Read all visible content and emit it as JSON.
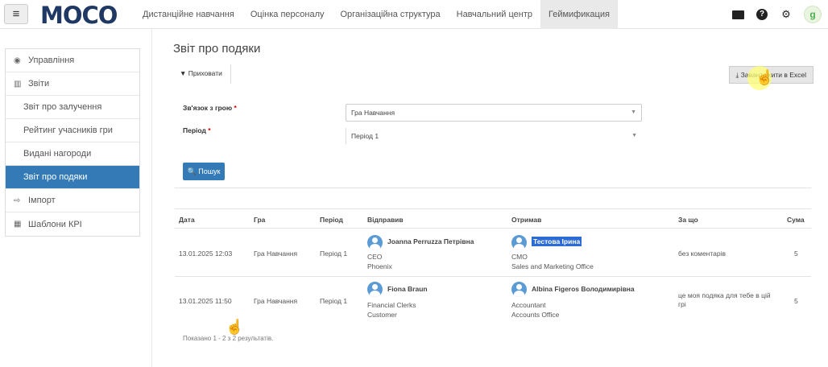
{
  "topbar": {
    "logo": "MOCO",
    "nav": [
      {
        "label": "Дистанційне навчання"
      },
      {
        "label": "Оцінка персоналу"
      },
      {
        "label": "Організаційна структура"
      },
      {
        "label": "Навчальний центр"
      },
      {
        "label": "Геймификация"
      }
    ],
    "icons": [
      "envelope-icon",
      "question-icon",
      "gear-icon",
      "avatar"
    ]
  },
  "sidebar": {
    "items": [
      {
        "label": "Управління",
        "icon": "gamepad-icon"
      },
      {
        "label": "Звіти",
        "icon": "bar-chart-icon"
      },
      {
        "label": "Звіт про залучення"
      },
      {
        "label": "Рейтинг учасників гри"
      },
      {
        "label": "Видані нагороди"
      },
      {
        "label": "Звіт про подяки"
      },
      {
        "label": "Імпорт",
        "icon": "import-icon"
      },
      {
        "label": "Шаблони КРІ",
        "icon": "table-icon"
      }
    ]
  },
  "main": {
    "title": "Звіт про подяки",
    "filter_button": "Приховати",
    "export_button": "Завантажити в Excel",
    "form": {
      "game_label": "Зв'язок з грою",
      "game_value": "Гра Навчання",
      "period_label": "Період",
      "period_value": "Період 1",
      "search_button": "Пошук"
    },
    "table": {
      "headers": [
        "Дата",
        "Гра",
        "Період",
        "Відправив",
        "Отримав",
        "За що",
        "Сума"
      ],
      "rows": [
        {
          "date": "13.01.2025 12:03",
          "game": "Гра Навчання",
          "period": "Період 1",
          "sender": {
            "name": "Joanna Perruzza Петрівна",
            "position": "CEO",
            "department": "Phoenix"
          },
          "receiver": {
            "name": "Тестова Ірина",
            "position": "CMO",
            "department": "Sales and Marketing Office"
          },
          "reason": "без коментарів",
          "amount": "5"
        },
        {
          "date": "13.01.2025 11:50",
          "game": "Гра Навчання",
          "period": "Період 1",
          "sender": {
            "name": "Fiona Braun",
            "position": "Financial Clerks",
            "department": "Customer"
          },
          "receiver": {
            "name": "Albina Figeros Володимирівна",
            "position": "Accountant",
            "department": "Accounts Office"
          },
          "reason": "це моя подяка для тебе в цій грі",
          "amount": "5"
        }
      ]
    },
    "footer": "Показано 1 - 2 з 2 результатів."
  },
  "colors": {
    "accent": "#337ab7",
    "highlight": "#2d6bd4",
    "logo": "#1f3864"
  }
}
